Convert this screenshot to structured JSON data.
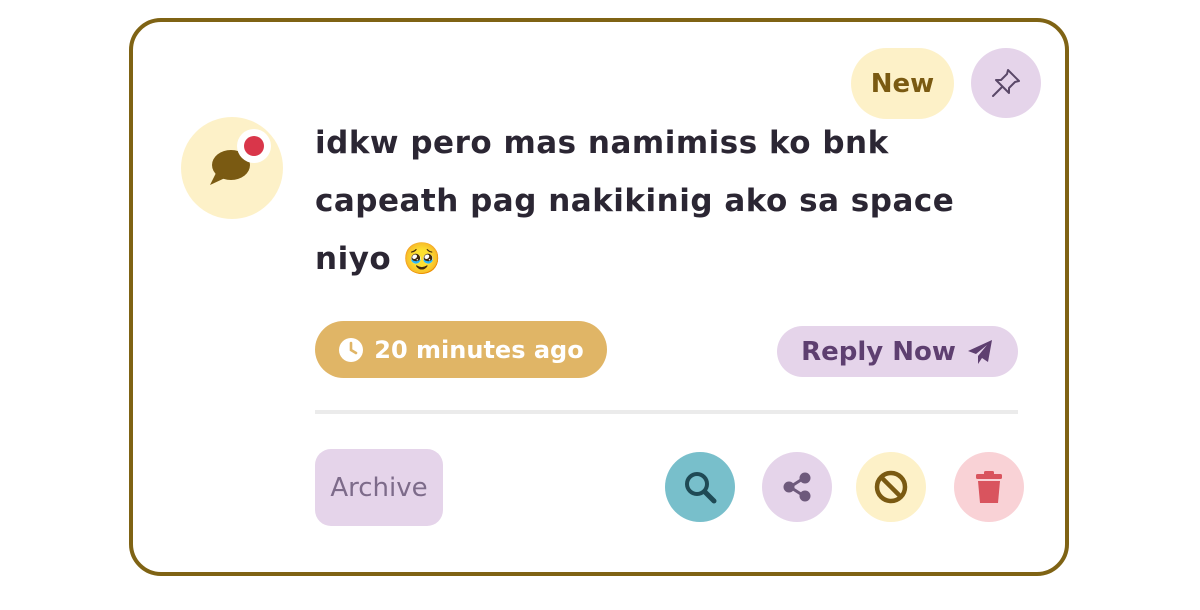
{
  "badge": {
    "label": "New"
  },
  "message": {
    "text": "idkw pero mas namimiss ko bnk capeath pag nakikinig ako sa space niyo 🥹"
  },
  "time": {
    "label": "20 minutes ago",
    "icon": "clock-icon"
  },
  "reply": {
    "label": "Reply Now",
    "icon": "paper-plane-icon"
  },
  "archive": {
    "label": "Archive"
  },
  "actions": [
    {
      "name": "search",
      "icon": "search-icon",
      "color": "#78bfcb"
    },
    {
      "name": "share",
      "icon": "share-icon",
      "color": "#e5d4ea"
    },
    {
      "name": "block",
      "icon": "block-icon",
      "color": "#fdf1c8"
    },
    {
      "name": "delete",
      "icon": "trash-icon",
      "color": "#f9d2d6"
    }
  ],
  "colors": {
    "border": "#7f6314",
    "accent_gold": "#e0b566",
    "accent_lavender": "#e5d4ea",
    "accent_cream": "#fdf1c8",
    "notification_red": "#d9364a"
  }
}
